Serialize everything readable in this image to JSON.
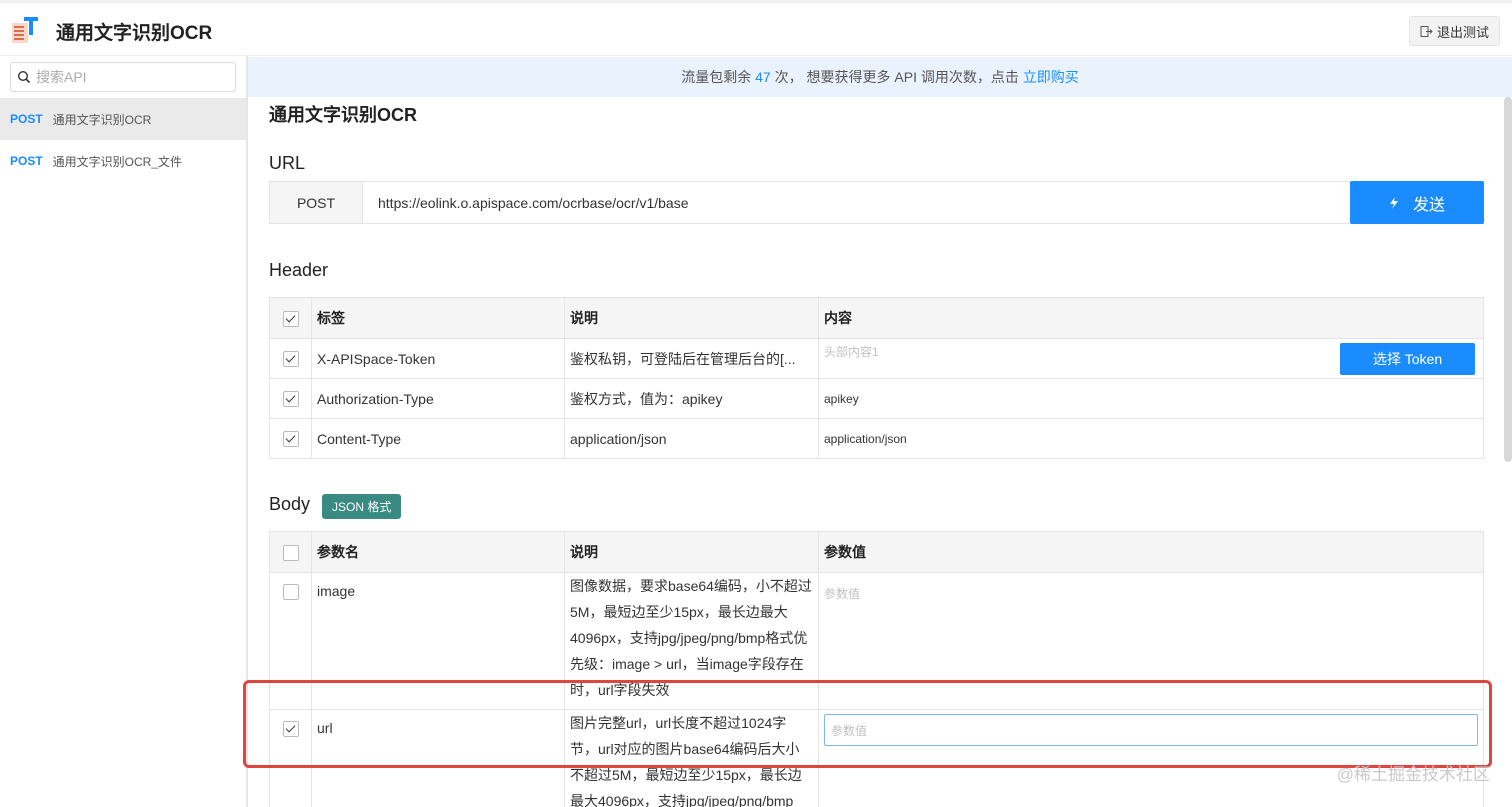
{
  "header": {
    "title": "通用文字识别OCR",
    "exit_label": "退出测试"
  },
  "sidebar": {
    "search_placeholder": "搜索API",
    "items": [
      {
        "method": "POST",
        "label": "通用文字识别OCR"
      },
      {
        "method": "POST",
        "label": "通用文字识别OCR_文件"
      }
    ]
  },
  "banner": {
    "prefix": "流量包剩余",
    "count": "47",
    "mid": "次， 想要获得更多 API 调用次数，点击",
    "link": "立即购买"
  },
  "main": {
    "title": "通用文字识别OCR",
    "url_section": "URL",
    "method": "POST",
    "url": "https://eolink.o.apispace.com/ocrbase/ocr/v1/base",
    "send_label": "发送",
    "header_section": "Header",
    "header_cols": [
      "标签",
      "说明",
      "内容"
    ],
    "header_rows": [
      {
        "checked": true,
        "name": "X-APISpace-Token",
        "desc": "鉴权私钥，可登陆后在管理后台的[...",
        "value_placeholder": "头部内容1",
        "button": "选择 Token"
      },
      {
        "checked": true,
        "name": "Authorization-Type",
        "desc": "鉴权方式，值为：apikey",
        "value": "apikey"
      },
      {
        "checked": true,
        "name": "Content-Type",
        "desc": "application/json",
        "value": "application/json"
      }
    ],
    "body_section": "Body",
    "body_badge": "JSON 格式",
    "body_cols": [
      "参数名",
      "说明",
      "参数值"
    ],
    "body_rows": [
      {
        "checked": false,
        "name": "image",
        "desc": "图像数据，要求base64编码，小不超过5M，最短边至少15px，最长边最大4096px，支持jpg/jpeg/png/bmp格式优先级：image > url，当image字段存在时，url字段失效",
        "value_placeholder": "参数值"
      },
      {
        "checked": true,
        "name": "url",
        "desc": "图片完整url，url长度不超过1024字节，url对应的图片base64编码后大小不超过5M，最短边至少15px，最长边最大4096px，支持jpg/jpeg/png/bmp",
        "value_placeholder": "参数值"
      }
    ]
  },
  "watermark": "@稀土掘金技术社区",
  "colors": {
    "accent": "#1a8cff",
    "badge": "#3a8a84",
    "highlight": "#e0463f",
    "banner_bg": "#eaf3fd"
  }
}
